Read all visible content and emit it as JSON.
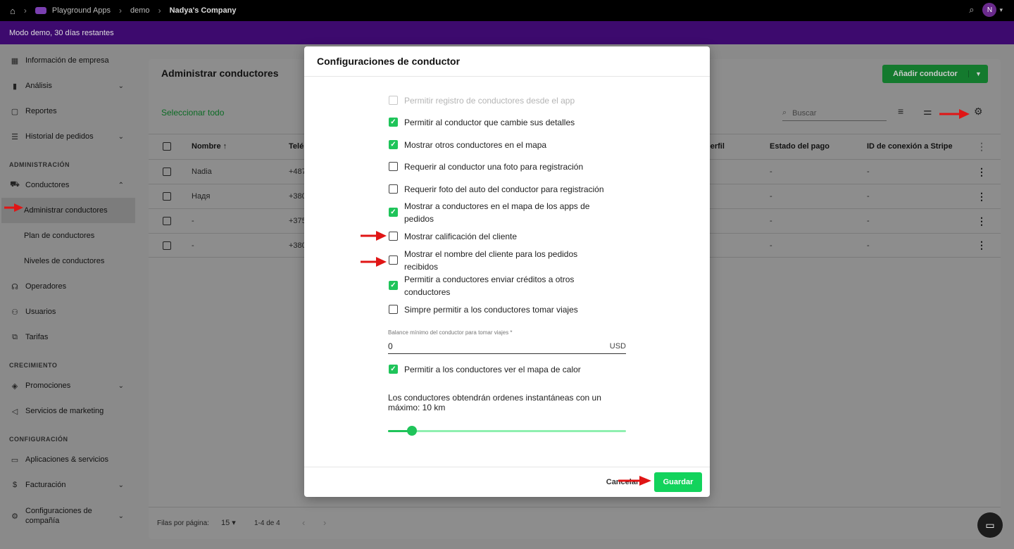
{
  "topbar": {
    "app_name": "Playground Apps",
    "crumb2": "demo",
    "crumb3": "Nadya's Company",
    "avatar_initial": "N"
  },
  "banner": {
    "text": "Modo demo, 30 días restantes"
  },
  "sidebar": {
    "items": [
      {
        "label": "Información de empresa",
        "icon": "dashboard-icon"
      },
      {
        "label": "Análisis",
        "icon": "bar-chart-icon"
      },
      {
        "label": "Reportes",
        "icon": "file-icon"
      },
      {
        "label": "Historial de pedidos",
        "icon": "list-icon"
      },
      {
        "label": "Conductores",
        "icon": "car-icon"
      },
      {
        "label": "Administrar conductores"
      },
      {
        "label": "Plan de conductores"
      },
      {
        "label": "Niveles de conductores"
      },
      {
        "label": "Operadores",
        "icon": "headset-icon"
      },
      {
        "label": "Usuarios",
        "icon": "users-icon"
      },
      {
        "label": "Tarifas",
        "icon": "tariff-icon"
      },
      {
        "label": "Promociones",
        "icon": "tag-icon"
      },
      {
        "label": "Servicios de marketing",
        "icon": "megaphone-icon"
      },
      {
        "label": "Aplicaciones & servicios",
        "icon": "devices-icon"
      },
      {
        "label": "Facturación",
        "icon": "billing-icon"
      },
      {
        "label": "Configuraciones de compañía",
        "icon": "gear-icon"
      }
    ],
    "sections": [
      "ADMINISTRACIÓN",
      "CRECIMIENTO",
      "CONFIGURACIÓN"
    ]
  },
  "main": {
    "title": "Administrar conductores",
    "add_button": "Añadir conductor",
    "select_all": "Seleccionar todo",
    "search_placeholder": "Buscar",
    "columns": [
      "Nombre",
      "Telé",
      "perfil",
      "Estado del pago",
      "ID de conexión a Stripe"
    ],
    "rows": [
      {
        "name": "Nadia",
        "phone": "+487",
        "pay": "-",
        "stripe": "-"
      },
      {
        "name": "Надя",
        "phone": "+380",
        "pay": "-",
        "stripe": "-"
      },
      {
        "name": "-",
        "phone": "+375",
        "pay": "-",
        "stripe": "-"
      },
      {
        "name": "-",
        "phone": "+380",
        "pay": "-",
        "stripe": "-"
      }
    ],
    "footer": {
      "rows_label": "Filas por página:",
      "rows_value": "15",
      "range": "1-4 de 4"
    }
  },
  "modal": {
    "title": "Configuraciones de conductor",
    "options": [
      {
        "label": "Permitir registro de conductores desde el app",
        "checked": false,
        "disabled": true
      },
      {
        "label": "Permitir al conductor que cambie sus detalles",
        "checked": true
      },
      {
        "label": "Mostrar otros conductores en el mapa",
        "checked": true
      },
      {
        "label": "Requerir al conductor una foto para registración",
        "checked": false
      },
      {
        "label": "Requerir foto del auto del conductor para registración",
        "checked": false
      },
      {
        "label": "Mostrar a conductores en el mapa de los apps de pedidos",
        "checked": true
      },
      {
        "label": "Mostrar calificación del cliente",
        "checked": false
      },
      {
        "label": "Mostrar el nombre del cliente para los pedidos recibidos",
        "checked": false
      },
      {
        "label": "Permitir a conductores enviar créditos a otros conductores",
        "checked": true
      },
      {
        "label": "Simpre permitir a los conductores tomar viajes",
        "checked": false
      },
      {
        "label": "Permitir a los conductores ver el mapa de calor",
        "checked": true
      }
    ],
    "balance_label": "Balance mínimo del conductor para tomar viajes *",
    "balance_value": "0",
    "balance_unit": "USD",
    "slider_text": "Los conductores obtendrán ordenes instantáneas con un máximo: 10 km",
    "slider_fraction": 0.1,
    "cancel": "Cancelar",
    "save": "Guardar"
  },
  "colors": {
    "accent": "#1fc45a",
    "banner": "#3d0a6e",
    "arrow": "#e01515"
  }
}
